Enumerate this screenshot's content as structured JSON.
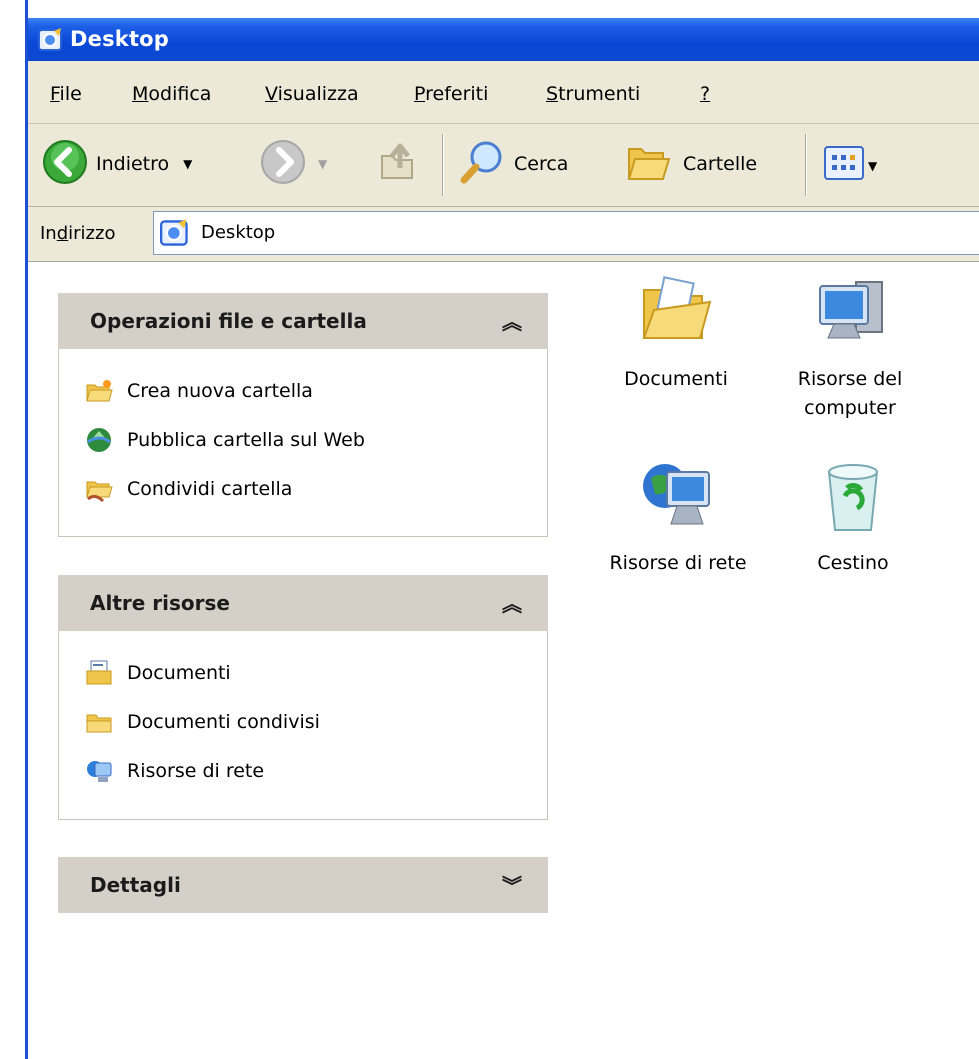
{
  "window": {
    "title": "Desktop"
  },
  "menu": [
    {
      "label": "File",
      "acc": "F",
      "rest": "ile"
    },
    {
      "label": "Modifica",
      "acc": "M",
      "rest": "odifica"
    },
    {
      "label": "Visualizza",
      "acc": "V",
      "rest": "isualizza"
    },
    {
      "label": "Preferiti",
      "acc": "P",
      "rest": "referiti"
    },
    {
      "label": "Strumenti",
      "acc": "S",
      "rest": "trumenti"
    },
    {
      "label": "?",
      "acc": "?",
      "rest": ""
    }
  ],
  "toolbar": {
    "back_label": "Indietro",
    "search_label": "Cerca",
    "folders_label": "Cartelle"
  },
  "address": {
    "label_pre": "In",
    "label_acc": "d",
    "label_post": "irizzo",
    "value": "Desktop"
  },
  "panels": {
    "file_tasks": {
      "title": "Operazioni file e cartella",
      "items": [
        "Crea nuova cartella",
        "Pubblica cartella sul Web",
        "Condividi cartella"
      ]
    },
    "other_places": {
      "title": "Altre risorse",
      "items": [
        "Documenti",
        "Documenti condivisi",
        "Risorse di rete"
      ]
    },
    "details": {
      "title": "Dettagli"
    }
  },
  "desktop_items": [
    {
      "line1": "Documenti",
      "line2": ""
    },
    {
      "line1": "Risorse del",
      "line2": "computer"
    },
    {
      "line1": "Risorse di rete",
      "line2": ""
    },
    {
      "line1": "Cestino",
      "line2": ""
    }
  ],
  "colors": {
    "titlebar": "#0a47d6",
    "toolbar_bg": "#ece9d8",
    "panel_header": "#d4d0c8"
  }
}
